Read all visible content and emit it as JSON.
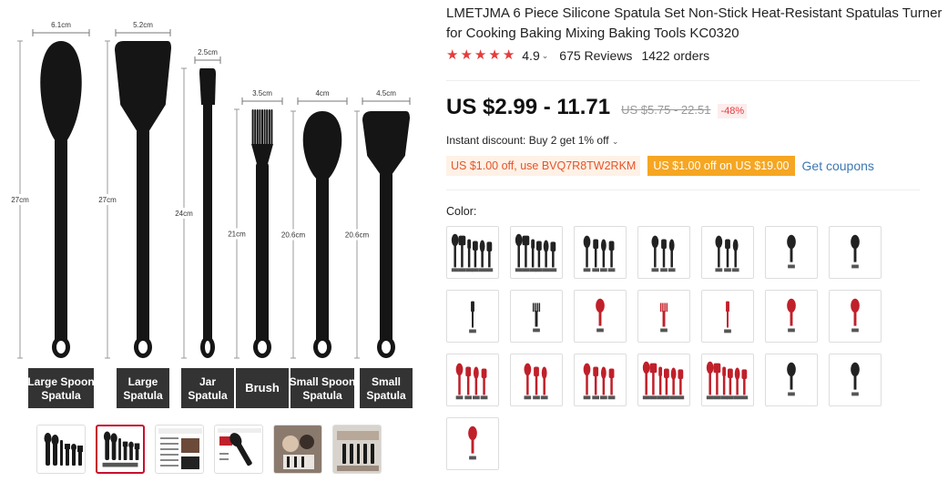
{
  "product": {
    "title": "LMETJMA 6 Piece Silicone Spatula Set Non-Stick Heat-Resistant Spatulas Turner for Cooking Baking Mixing Baking Tools KC0320",
    "rating": "4.9",
    "reviews": "675 Reviews",
    "orders": "1422 orders",
    "price": "US $2.99 - 11.71",
    "old_price": "US $5.75 - 22.51",
    "discount": "-48%",
    "instant_discount": "Instant discount: Buy 2 get 1% off",
    "coupon_code": "US $1.00 off, use BVQ7R8TW2RKM",
    "coupon_offer": "US $1.00 off on US $19.00",
    "get_coupons": "Get coupons",
    "color_label": "Color:"
  },
  "image": {
    "dims": [
      "6.1cm",
      "5.2cm",
      "2.5cm",
      "3.5cm",
      "4cm",
      "4.5cm"
    ],
    "lengths": [
      "27cm",
      "27cm",
      "24cm",
      "21cm",
      "20.6cm",
      "20.6cm"
    ],
    "labels": [
      [
        "Large Spoon",
        "Spatula"
      ],
      [
        "Large",
        "Spatula"
      ],
      [
        "Jar",
        "Spatula"
      ],
      [
        "Brush",
        ""
      ],
      [
        "Small Spoon",
        "Spatula"
      ],
      [
        "Small",
        "Spatula"
      ]
    ]
  },
  "colors": {
    "accent": "#e43c3c",
    "coupon_orange": "#f5a623",
    "link_blue": "#3c78b4",
    "swatches": [
      {
        "kind": "set6",
        "color": "#222"
      },
      {
        "kind": "set6",
        "color": "#222"
      },
      {
        "kind": "set4",
        "color": "#222"
      },
      {
        "kind": "set3",
        "color": "#222"
      },
      {
        "kind": "set3",
        "color": "#222"
      },
      {
        "kind": "one",
        "color": "#222"
      },
      {
        "kind": "one",
        "color": "#222"
      },
      {
        "kind": "one-thin",
        "color": "#222"
      },
      {
        "kind": "brush",
        "color": "#222"
      },
      {
        "kind": "one",
        "color": "#c0202a"
      },
      {
        "kind": "brush",
        "color": "#c0202a"
      },
      {
        "kind": "one-thin",
        "color": "#c0202a"
      },
      {
        "kind": "one",
        "color": "#c0202a"
      },
      {
        "kind": "one",
        "color": "#c0202a"
      },
      {
        "kind": "set4",
        "color": "#c0202a"
      },
      {
        "kind": "set3",
        "color": "#c0202a"
      },
      {
        "kind": "set4",
        "color": "#c0202a"
      },
      {
        "kind": "set6",
        "color": "#c0202a"
      },
      {
        "kind": "set6",
        "color": "#c0202a"
      },
      {
        "kind": "one",
        "color": "#222"
      },
      {
        "kind": "one",
        "color": "#222"
      },
      {
        "kind": "one",
        "color": "#c0202a"
      }
    ]
  }
}
